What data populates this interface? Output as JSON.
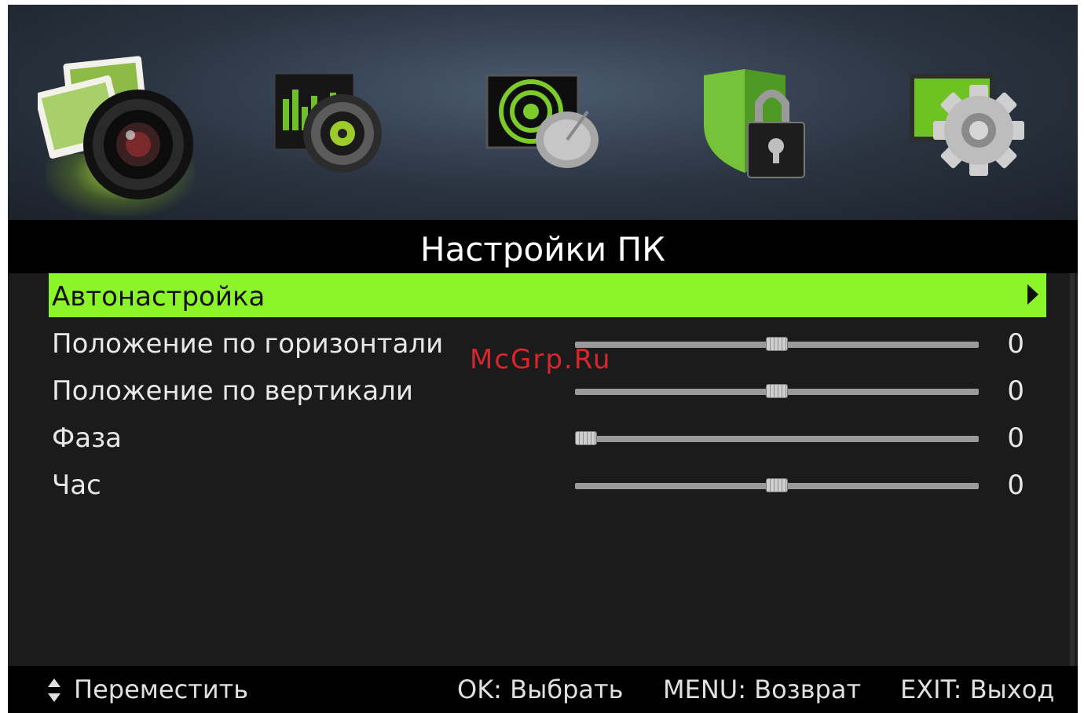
{
  "header": {
    "icons": [
      {
        "name": "picture-icon",
        "active": true
      },
      {
        "name": "sound-icon",
        "active": false
      },
      {
        "name": "channel-icon",
        "active": false
      },
      {
        "name": "lock-icon",
        "active": false
      },
      {
        "name": "settings-icon",
        "active": false
      }
    ]
  },
  "title": "Настройки ПК",
  "menu": {
    "items": [
      {
        "label": "Автонастройка",
        "selected": true
      },
      {
        "label": "Положение по горизонтали",
        "value": "0",
        "level": 0.5
      },
      {
        "label": "Положение по вертикали",
        "value": "0",
        "level": 0.5
      },
      {
        "label": "Фаза",
        "value": "0",
        "level": 0.0
      },
      {
        "label": "Час",
        "value": "0",
        "level": 0.5
      }
    ]
  },
  "footer": {
    "move": "Переместить",
    "ok": "OK: Выбрать",
    "menu": "MENU: Возврат",
    "exit": "EXIT: Выход"
  },
  "watermark": "McGrp.Ru",
  "colors": {
    "accent": "#8cf52a",
    "background": "#1b1b1c"
  }
}
